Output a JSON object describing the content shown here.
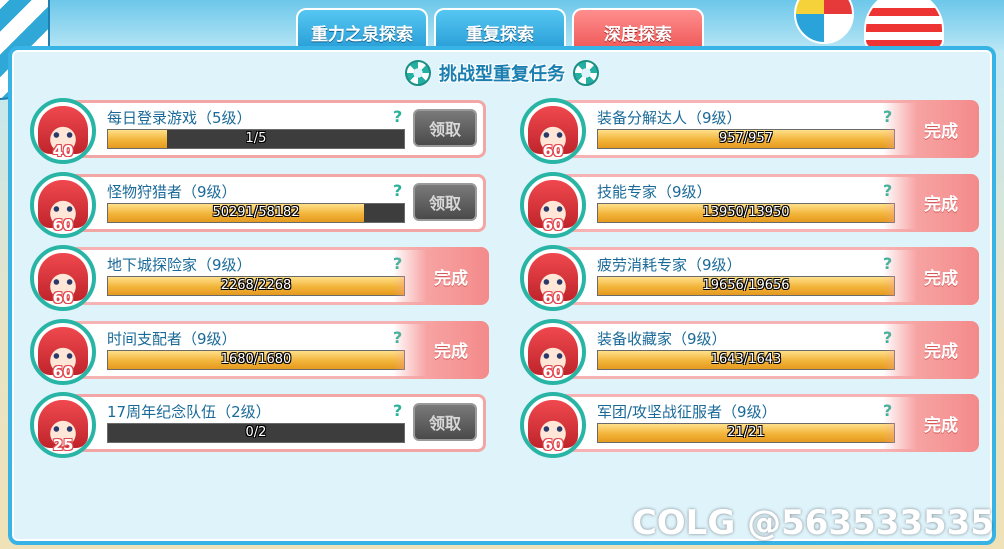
{
  "tabs": [
    {
      "label": "重力之泉探索",
      "active": false
    },
    {
      "label": "重复探索",
      "active": false
    },
    {
      "label": "深度探索",
      "active": true
    }
  ],
  "panel_title": "挑战型重复任务",
  "claim_label": "领取",
  "done_label": "完成",
  "help_glyph": "?",
  "tasks_left": [
    {
      "name": "每日登录游戏（5级）",
      "level": "40",
      "progress": "1/5",
      "fraction": 0.2,
      "status": "claim"
    },
    {
      "name": "怪物狩猎者（9级）",
      "level": "60",
      "progress": "50291/58182",
      "fraction": 0.864,
      "status": "claim"
    },
    {
      "name": "地下城探险家（9级）",
      "level": "60",
      "progress": "2268/2268",
      "fraction": 1.0,
      "status": "done"
    },
    {
      "name": "时间支配者（9级）",
      "level": "60",
      "progress": "1680/1680",
      "fraction": 1.0,
      "status": "done"
    },
    {
      "name": "17周年纪念队伍（2级）",
      "level": "25",
      "progress": "0/2",
      "fraction": 0.0,
      "status": "claim"
    }
  ],
  "tasks_right": [
    {
      "name": "装备分解达人（9级）",
      "level": "60",
      "progress": "957/957",
      "fraction": 1.0,
      "status": "done"
    },
    {
      "name": "技能专家（9级）",
      "level": "60",
      "progress": "13950/13950",
      "fraction": 1.0,
      "status": "done"
    },
    {
      "name": "疲劳消耗专家（9级）",
      "level": "60",
      "progress": "19656/19656",
      "fraction": 1.0,
      "status": "done"
    },
    {
      "name": "装备收藏家（9级）",
      "level": "60",
      "progress": "1643/1643",
      "fraction": 1.0,
      "status": "done"
    },
    {
      "name": "军团/攻坚战征服者（9级）",
      "level": "60",
      "progress": "21/21",
      "fraction": 1.0,
      "status": "done"
    }
  ],
  "watermark": "COLG @563533535",
  "colors": {
    "tab_active": "#f05a5a",
    "tab_inactive": "#2a9fd8",
    "avatar_ring": "#29b5a5",
    "bar_fill": "#f2b43a",
    "done_tag": "#f48a8a"
  }
}
